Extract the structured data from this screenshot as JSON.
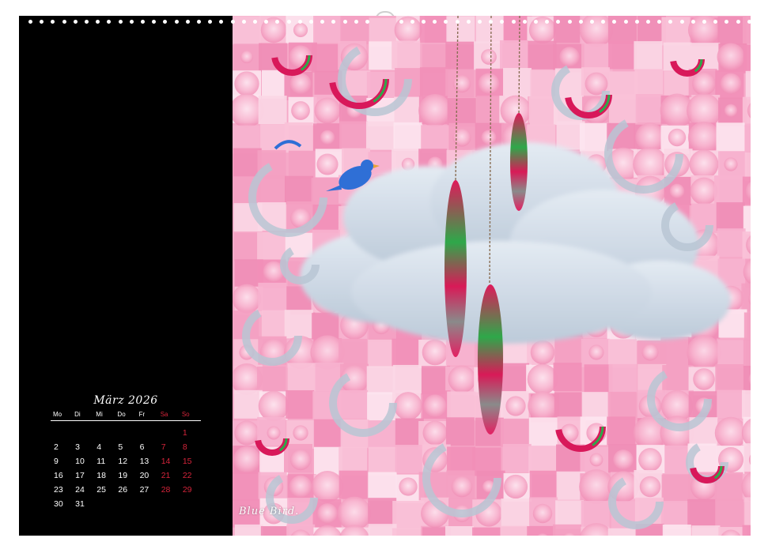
{
  "calendar": {
    "month_title": "März 2026",
    "weekdays": [
      {
        "label": "Mo",
        "weekend": false
      },
      {
        "label": "Di",
        "weekend": false
      },
      {
        "label": "Mi",
        "weekend": false
      },
      {
        "label": "Do",
        "weekend": false
      },
      {
        "label": "Fr",
        "weekend": false
      },
      {
        "label": "Sa",
        "weekend": true
      },
      {
        "label": "So",
        "weekend": true
      }
    ],
    "leading_blank_days": 6,
    "days": [
      "1",
      "2",
      "3",
      "4",
      "5",
      "6",
      "7",
      "8",
      "9",
      "10",
      "11",
      "12",
      "13",
      "14",
      "15",
      "16",
      "17",
      "18",
      "19",
      "20",
      "21",
      "22",
      "23",
      "24",
      "25",
      "26",
      "27",
      "28",
      "29",
      "30",
      "31"
    ]
  },
  "artwork": {
    "signature": "Blue Bird.",
    "colors": {
      "panel": "#000000",
      "weekend": "#d4243a",
      "petal_pink": "#f7a8c9",
      "cloud": "#c9d5e3",
      "bird": "#2f6fd6",
      "ring": "#b9c6d3"
    }
  }
}
